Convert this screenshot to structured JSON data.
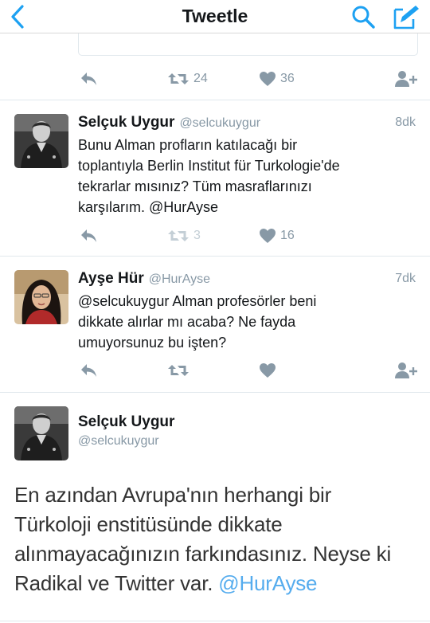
{
  "nav": {
    "title": "Tweetle",
    "back_icon": "chevron-left-icon",
    "search_icon": "search-icon",
    "compose_icon": "compose-icon",
    "accent": "#1da1f2"
  },
  "colors": {
    "icon_gray": "#8899a6",
    "icon_light": "#c4cfd6",
    "mention": "#55acee"
  },
  "timeline": [
    {
      "actions": {
        "retweets": "24",
        "likes": "36"
      }
    },
    {
      "name": "Selçuk Uygur",
      "handle": "@selcukuygur",
      "time": "8dk",
      "lines": [
        "Bunu Alman profların katılacağı bir",
        "toplantıyla Berlin Institut für Turkologie'de",
        "tekrarlar mısınız? Tüm masraflarınızı",
        "karşılarım. @HurAyse"
      ],
      "actions": {
        "retweets": "3",
        "likes": "16"
      }
    },
    {
      "name": "Ayşe Hür",
      "handle": "@HurAyse",
      "time": "7dk",
      "lines": [
        "@selcukuygur Alman profesörler beni",
        "dikkate alırlar mı acaba? Ne fayda",
        "umuyorsunuz bu işten?"
      ],
      "actions": {
        "retweets": "",
        "likes": ""
      }
    }
  ],
  "detail": {
    "name": "Selçuk Uygur",
    "handle": "@selcukuygur",
    "lines": [
      "En azından Avrupa'nın herhangi bir",
      "Türkoloji enstitüsünde dikkate",
      "alınmayacağınızın farkındasınız. Neyse ki",
      "Radikal ve Twitter var. "
    ],
    "mention": "@HurAyse"
  }
}
